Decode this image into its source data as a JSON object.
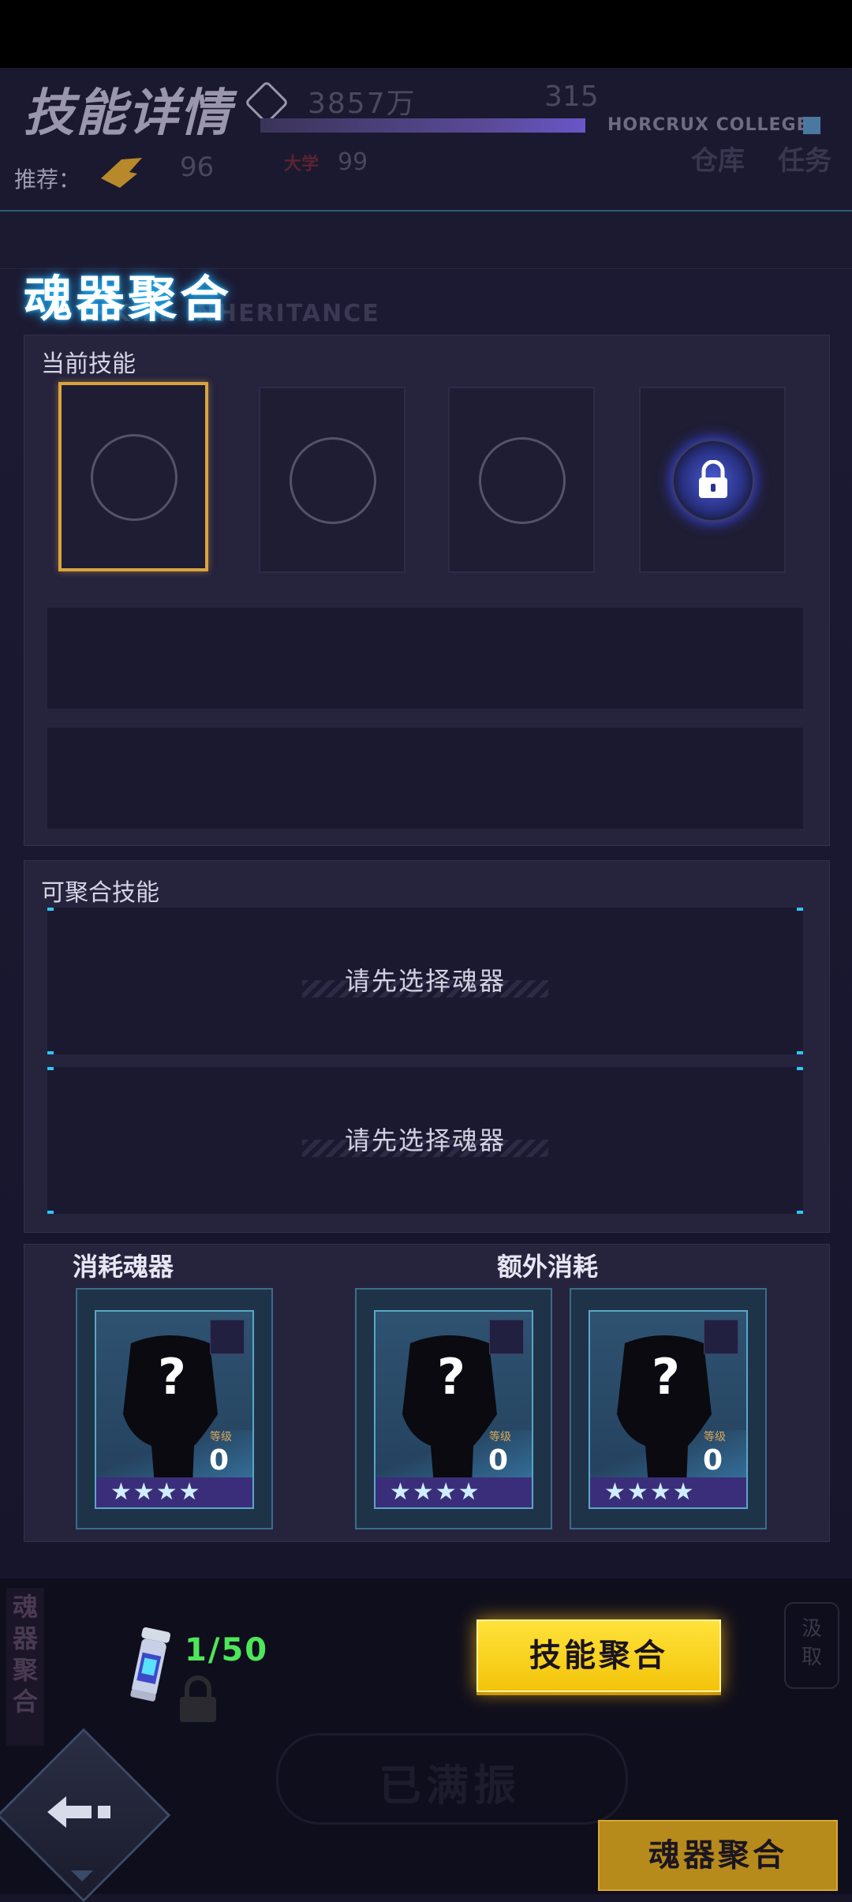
{
  "background": {
    "title": "技能详情",
    "gold": "3857万",
    "gems": "315",
    "college": "HORCRUX COLLEGE",
    "recommend_label": "推荐：",
    "recommend_value": "96",
    "university_label": "大学",
    "university_value": "99",
    "warehouse": "仓库",
    "task": "任务",
    "bottom_button": "已满振",
    "side_tab": "魂器聚合",
    "right_ghost": "汲取"
  },
  "dialog": {
    "title": "魂器聚合",
    "subtitle": "SKILL INHERITANCE",
    "current_skills_label": "当前技能",
    "slots": [
      {
        "state": "empty",
        "selected": true
      },
      {
        "state": "empty",
        "selected": false
      },
      {
        "state": "empty",
        "selected": false
      },
      {
        "state": "locked",
        "selected": false
      }
    ],
    "mergeable_label": "可聚合技能",
    "merge_placeholders": [
      "请先选择魂器",
      "请先选择魂器"
    ],
    "consume_label": "消耗魂器",
    "extra_label": "额外消耗",
    "cards": [
      {
        "question": "?",
        "level_label": "等级",
        "level": "0",
        "stars": "★★★★"
      },
      {
        "question": "?",
        "level_label": "等级",
        "level": "0",
        "stars": "★★★★"
      },
      {
        "question": "?",
        "level_label": "等级",
        "level": "0",
        "stars": "★★★★"
      }
    ]
  },
  "footer": {
    "item_count": "1/50",
    "merge_button": "技能聚合",
    "bottom_merge_button": "魂器聚合"
  },
  "colors": {
    "accent_gold": "#d9a440",
    "button_yellow": "#ffe23a",
    "count_green": "#4ee65a",
    "title_glow": "#22b4ff"
  }
}
